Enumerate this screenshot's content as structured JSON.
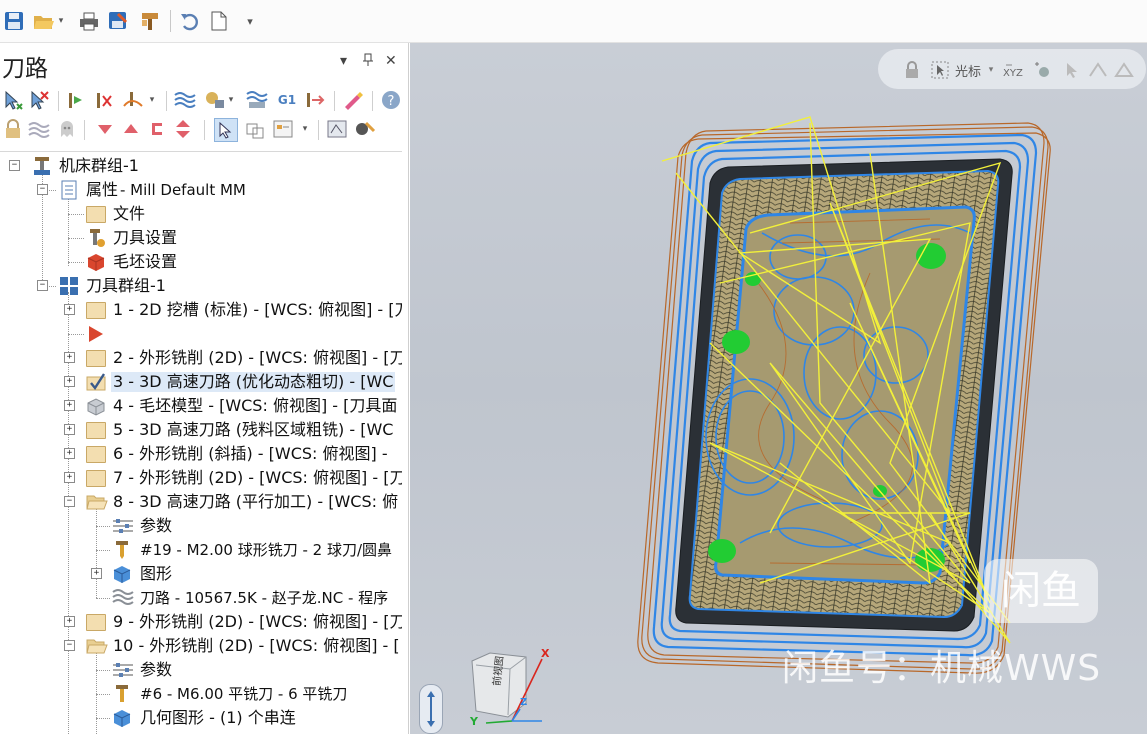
{
  "qat": {
    "buttons": [
      "save-icon",
      "open-icon",
      "print-icon",
      "save-as-icon",
      "merge-icon",
      "undo-icon",
      "new-icon",
      "customize-icon"
    ]
  },
  "panel": {
    "title": "刀路",
    "controls": {
      "menu": "▾",
      "pin": "ㅁ",
      "close": "✕"
    }
  },
  "tree": {
    "machine_group": "机床群组-1",
    "properties": {
      "label": "属性",
      "value": " - Mill Default MM"
    },
    "files": "文件",
    "tool_settings": "刀具设置",
    "stock_settings": "毛坯设置",
    "toolgroup": "刀具群组-1",
    "ops": [
      "1 - 2D 挖槽 (标准) - [WCS: 俯视图] - [刀",
      "2 - 外形铣削 (2D) - [WCS: 俯视图] - [刀",
      "3 - 3D 高速刀路 (优化动态粗切) - [WC",
      "4 - 毛坯模型 - [WCS: 俯视图] - [刀具面",
      "5 - 3D 高速刀路 (残料区域粗铣) - [WC",
      "6 - 外形铣削 (斜插) - [WCS: 俯视图] -",
      "7 - 外形铣削 (2D) - [WCS: 俯视图] - [刀",
      "8 - 3D 高速刀路 (平行加工) - [WCS: 俯",
      "9 - 外形铣削 (2D) - [WCS: 俯视图] - [刀",
      "10 - 外形铣削 (2D) - [WCS: 俯视图] - ["
    ],
    "op8_children": {
      "params": "参数",
      "tool": "#19 - M2.00 球形铣刀 - 2 球刀/圆鼻",
      "geometry": "图形",
      "toolpath": "刀路 - 10567.5K - 赵子龙.NC - 程序"
    },
    "op10_children": {
      "params": "参数",
      "tool": "#6 - M6.00 平铣刀 - 6 平铣刀",
      "geometry": "几何图形 - (1) 个串连"
    }
  },
  "viewport": {
    "toolbar_label": "光标",
    "watermark_badge": "闲鱼",
    "watermark_text": "闲鱼号：机械WWS",
    "axes": {
      "x": "X",
      "y": "Y",
      "z": "Z"
    },
    "cube_face": "前视图"
  },
  "colors": {
    "toolpath_blue": "#2f86e6",
    "toolpath_orange": "#b8682a",
    "rapid_yellow": "#f2f03a",
    "marker_green": "#22cc33",
    "viewport_bg": "#c5cad2"
  }
}
